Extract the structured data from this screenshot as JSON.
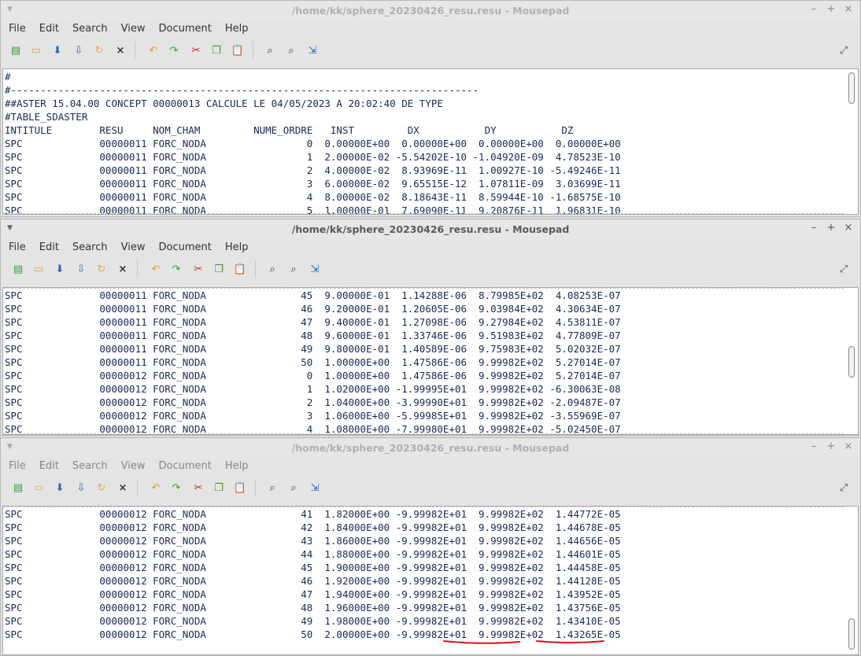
{
  "title": "/home/kk/sphere_20230426_resu.resu - Mousepad",
  "window_controls": {
    "minimize": "–",
    "maximize": "+",
    "close": "×"
  },
  "menu": [
    "File",
    "Edit",
    "Search",
    "View",
    "Document",
    "Help"
  ],
  "toolbar_icons": [
    "new-document-icon",
    "open-folder-icon",
    "save-icon",
    "save-as-icon",
    "reload-icon",
    "close-document-icon",
    "undo-icon",
    "redo-icon",
    "cut-icon",
    "copy-icon",
    "paste-icon",
    "find-icon",
    "find-replace-icon",
    "go-to-line-icon",
    "fullscreen-icon"
  ],
  "windows": [
    {
      "lines": [
        "#",
        "#-------------------------------------------------------------------------------",
        "##ASTER 15.04.00 CONCEPT 00000013 CALCULE LE 04/05/2023 A 20:02:40 DE TYPE",
        "#TABLE_SDASTER",
        "INTITULE        RESU     NOM_CHAM         NUME_ORDRE   INST         DX           DY           DZ",
        "SPC             00000011 FORC_NODA                 0  0.00000E+00  0.00000E+00  0.00000E+00  0.00000E+00",
        "SPC             00000011 FORC_NODA                 1  2.00000E-02 -5.54202E-10 -1.04920E-09  4.78523E-10",
        "SPC             00000011 FORC_NODA                 2  4.00000E-02  8.93969E-11  1.00927E-10 -5.49246E-11",
        "SPC             00000011 FORC_NODA                 3  6.00000E-02  9.65515E-12  1.07811E-09  3.03699E-11",
        "SPC             00000011 FORC_NODA                 4  8.00000E-02  8.18643E-11  8.59944E-10 -1.68575E-10",
        "SPC             00000011 FORC_NODA                 5  1.00000E-01  7.69090E-11  9.20876E-11  1.96831E-10"
      ]
    },
    {
      "lines": [
        "SPC             00000011 FORC_NODA                45  9.00000E-01  1.14288E-06  8.79985E+02  4.08253E-07",
        "SPC             00000011 FORC_NODA                46  9.20000E-01  1.20605E-06  9.03984E+02  4.30634E-07",
        "SPC             00000011 FORC_NODA                47  9.40000E-01  1.27098E-06  9.27984E+02  4.53811E-07",
        "SPC             00000011 FORC_NODA                48  9.60000E-01  1.33746E-06  9.51983E+02  4.77809E-07",
        "SPC             00000011 FORC_NODA                49  9.80000E-01  1.40589E-06  9.75983E+02  5.02032E-07",
        "SPC             00000011 FORC_NODA                50  1.00000E+00  1.47586E-06  9.99982E+02  5.27014E-07",
        "SPC             00000012 FORC_NODA                 0  1.00000E+00  1.47586E-06  9.99982E+02  5.27014E-07",
        "SPC             00000012 FORC_NODA                 1  1.02000E+00 -1.99995E+01  9.99982E+02 -6.30063E-08",
        "SPC             00000012 FORC_NODA                 2  1.04000E+00 -3.99990E+01  9.99982E+02 -2.09487E-07",
        "SPC             00000012 FORC_NODA                 3  1.06000E+00 -5.99985E+01  9.99982E+02 -3.55969E-07",
        "SPC             00000012 FORC_NODA                 4  1.08000E+00 -7.99980E+01  9.99982E+02 -5.02450E-07"
      ]
    },
    {
      "lines": [
        "SPC             00000012 FORC_NODA                41  1.82000E+00 -9.99982E+01  9.99982E+02  1.44772E-05",
        "SPC             00000012 FORC_NODA                42  1.84000E+00 -9.99982E+01  9.99982E+02  1.44678E-05",
        "SPC             00000012 FORC_NODA                43  1.86000E+00 -9.99982E+01  9.99982E+02  1.44656E-05",
        "SPC             00000012 FORC_NODA                44  1.88000E+00 -9.99982E+01  9.99982E+02  1.44601E-05",
        "SPC             00000012 FORC_NODA                45  1.90000E+00 -9.99982E+01  9.99982E+02  1.44458E-05",
        "SPC             00000012 FORC_NODA                46  1.92000E+00 -9.99982E+01  9.99982E+02  1.44128E-05",
        "SPC             00000012 FORC_NODA                47  1.94000E+00 -9.99982E+01  9.99982E+02  1.43952E-05",
        "SPC             00000012 FORC_NODA                48  1.96000E+00 -9.99982E+01  9.99982E+02  1.43756E-05",
        "SPC             00000012 FORC_NODA                49  1.98000E+00 -9.99982E+01  9.99982E+02  1.43410E-05",
        "SPC             00000012 FORC_NODA                50  2.00000E+00 -9.99982E+01  9.99982E+02  1.43265E-05"
      ]
    }
  ],
  "annotation_color": "#e0101a"
}
